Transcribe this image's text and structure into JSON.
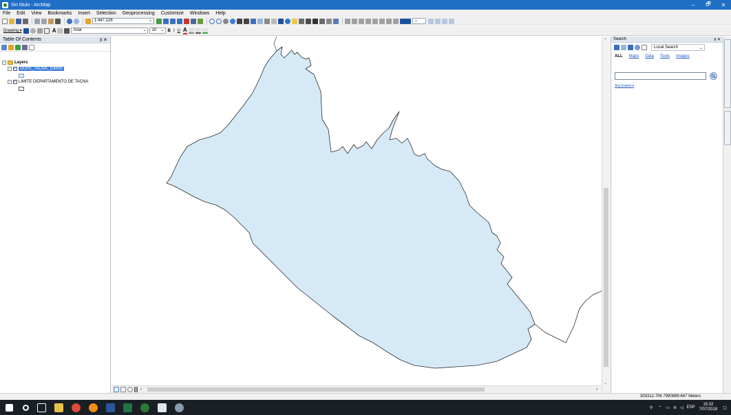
{
  "window": {
    "title": "Sin título - ArcMap",
    "buttons": [
      "–",
      "🗗",
      "✕"
    ]
  },
  "menubar": {
    "items": [
      "File",
      "Edit",
      "View",
      "Bookmarks",
      "Insert",
      "Selection",
      "Geoprocessing",
      "Customize",
      "Windows",
      "Help"
    ]
  },
  "toolbar": {
    "scale": "1:447.226",
    "drawing_label": "Drawing ▾",
    "font_name": "Arial",
    "font_size": "10",
    "bold": "B",
    "italic": "I",
    "underline": "U"
  },
  "toc": {
    "title": "Table Of Contents",
    "pin": "♯ ✕",
    "root_label": "Layers",
    "layers": [
      {
        "name": "DCPS_TACNA_1000m",
        "checked": true,
        "selected": true
      },
      {
        "name": "LIMITE DEPARTAMENTO DE TACNA",
        "checked": true,
        "selected": false
      }
    ]
  },
  "search": {
    "title": "Search",
    "pin": "♯ ✕",
    "scope": "Local Search",
    "tabs": [
      "ALL",
      "Maps",
      "Data",
      "Tools",
      "Images"
    ],
    "query": "",
    "extent_label": "Any Extent ▾"
  },
  "statusbar": {
    "coordinates": "303312.706  7990899.667 Meters"
  },
  "taskbar": {
    "language": "ESP",
    "time": "15:32",
    "date": "7/07/2018"
  },
  "colors": {
    "polygon_fill": "#d6e9f6",
    "titlebar": "#1f6fc6",
    "taskbar": "#1a1f26"
  }
}
